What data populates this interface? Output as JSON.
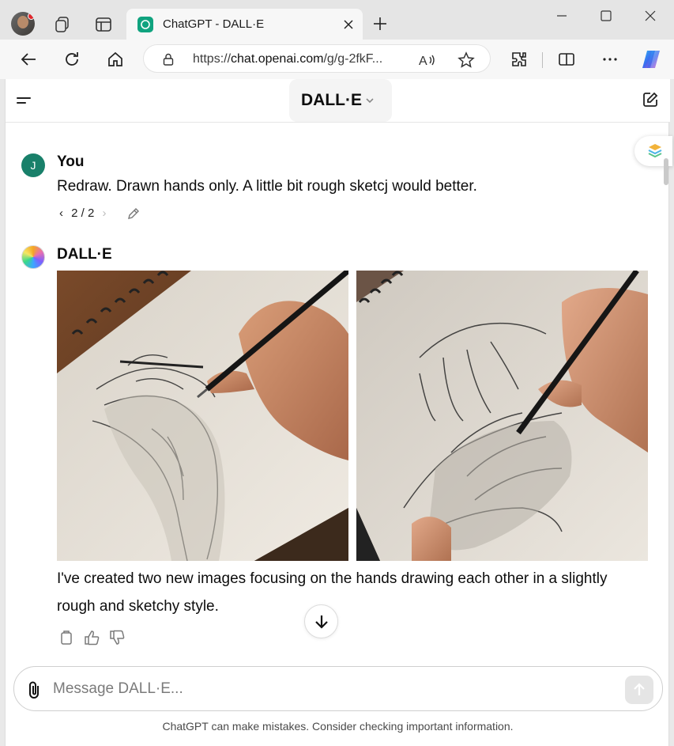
{
  "browser": {
    "tab_title": "ChatGPT - DALL·E",
    "url_prefix": "https://",
    "url_domain": "chat.openai.com",
    "url_rest": "/g/g-2fkF...",
    "read_aloud_label": "A",
    "icons": [
      "profile-avatar",
      "workspaces-icon",
      "tab-actions-icon",
      "chatgpt-favicon",
      "close-icon",
      "new-tab-icon",
      "minimize-icon",
      "maximize-icon",
      "window-close-icon",
      "back-icon",
      "refresh-icon",
      "home-icon",
      "lock-icon",
      "read-aloud-icon",
      "favorite-star-icon",
      "extensions-icon",
      "split-screen-icon",
      "more-icon",
      "copilot-icon"
    ]
  },
  "chat": {
    "model_name": "DALL·E",
    "user": {
      "initial": "J",
      "name": "You",
      "message": "Redraw. Drawn hands only. A little bit rough sketcj would better.",
      "pager": "2 / 2"
    },
    "assistant": {
      "name": "DALL·E",
      "reply_line1": "I've created two new images focusing on the hands drawing each other in a slightly",
      "reply_line2": "rough and sketchy style."
    },
    "composer": {
      "placeholder": "Message DALL·E..."
    },
    "disclaimer": "ChatGPT can make mistakes. Consider checking important information."
  },
  "colors": {
    "accent": "#10a37f",
    "user_avatar": "#19806a",
    "page_bg": "#ffffff",
    "browser_chrome": "#e5e5e5"
  }
}
